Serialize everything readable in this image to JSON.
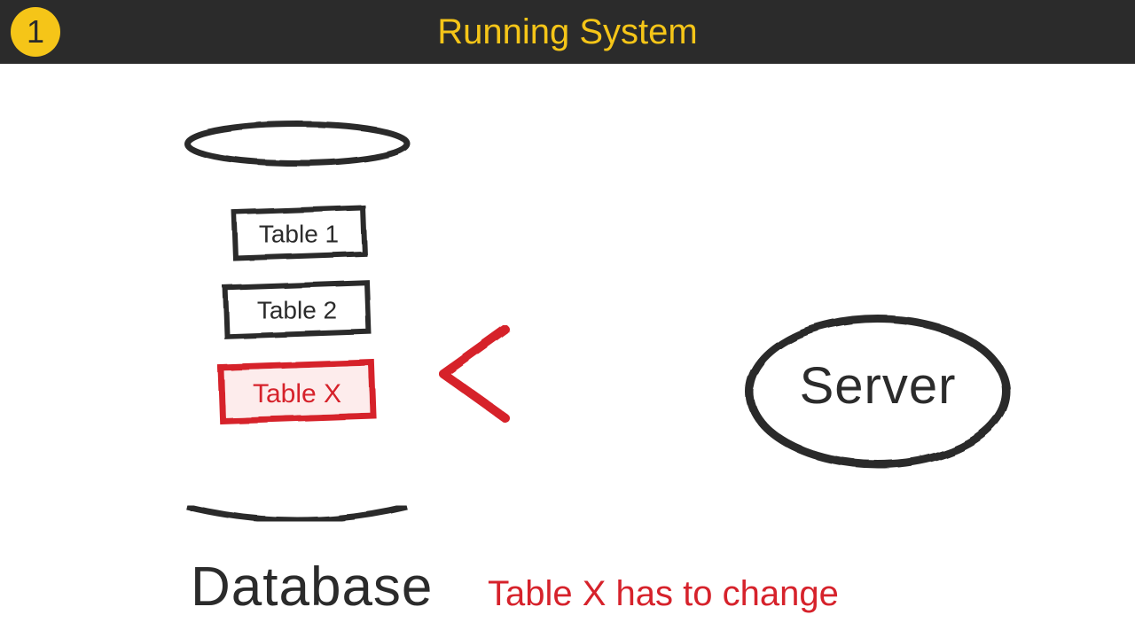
{
  "header": {
    "step": "1",
    "title": "Running System"
  },
  "diagram": {
    "database_label": "Database",
    "tables": {
      "t1": "Table 1",
      "t2": "Table 2",
      "tx": "Table X"
    },
    "server_label": "Server",
    "caption": "Table X has to change"
  },
  "colors": {
    "header_bg": "#2b2b2b",
    "accent_yellow": "#f5c518",
    "stroke_dark": "#2b2b2b",
    "highlight_red": "#d6222b",
    "highlight_fill": "#fdecec"
  }
}
